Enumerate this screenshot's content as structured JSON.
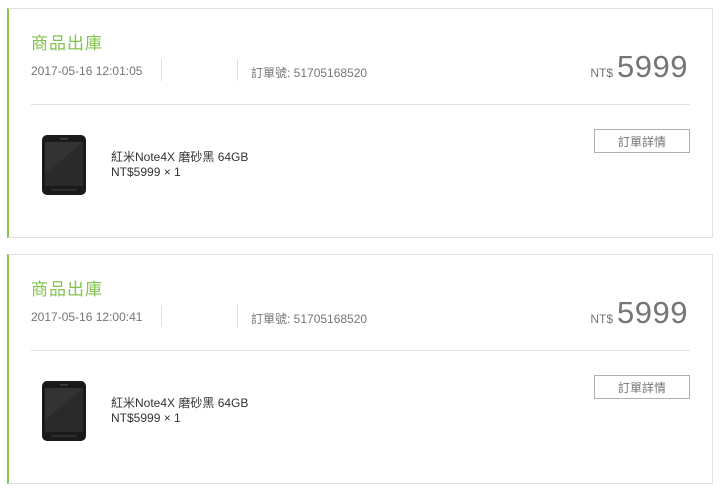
{
  "orders": [
    {
      "status": "商品出庫",
      "datetime": "2017-05-16 12:01:05",
      "order_number": "訂單號: 51705168520",
      "currency": "NT$",
      "total": "5999",
      "product": {
        "name": "紅米Note4X 磨砂黑 64GB",
        "price_qty": "NT$5999 × 1",
        "image_icon": "phone-icon"
      },
      "detail_label": "訂單詳情"
    },
    {
      "status": "商品出庫",
      "datetime": "2017-05-16 12:00:41",
      "order_number": "訂單號: 51705168520",
      "currency": "NT$",
      "total": "5999",
      "product": {
        "name": "紅米Note4X 磨砂黑 64GB",
        "price_qty": "NT$5999 × 1",
        "image_icon": "phone-icon"
      },
      "detail_label": "訂單詳情"
    }
  ],
  "colors": {
    "accent": "#83c44e",
    "text": "#333333",
    "muted": "#757575",
    "border": "#e0e0e0"
  }
}
